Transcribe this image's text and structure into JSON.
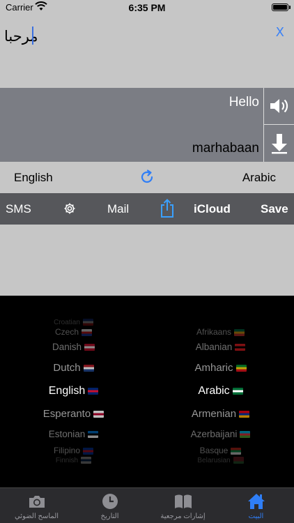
{
  "status": {
    "carrier": "Carrier",
    "time": "6:35 PM"
  },
  "input": {
    "text": "مرحبا",
    "clear_label": "X"
  },
  "output": {
    "source": "Hello",
    "transliteration": "marhabaan"
  },
  "languages": {
    "from": "English",
    "to": "Arabic"
  },
  "actions": {
    "sms": "SMS",
    "mail": "Mail",
    "icloud": "iCloud",
    "save": "Save"
  },
  "picker": {
    "left": [
      {
        "label": "Croatian",
        "flag": [
          "#1a3fa8",
          "#ffffff",
          "#d61c1c"
        ]
      },
      {
        "label": "Czech",
        "flag": [
          "#ffffff",
          "#d61c1c",
          "#1a3fa8"
        ]
      },
      {
        "label": "Danish",
        "flag": [
          "#c8102e",
          "#ffffff",
          "#c8102e"
        ]
      },
      {
        "label": "Dutch",
        "flag": [
          "#ae1c28",
          "#ffffff",
          "#21468b"
        ]
      },
      {
        "label": "English",
        "flag": [
          "#012169",
          "#c8102e",
          "#012169"
        ]
      },
      {
        "label": "Esperanto",
        "flag": [
          "#ffffff",
          "#bc002d",
          "#ffffff"
        ]
      },
      {
        "label": "Estonian",
        "flag": [
          "#0072ce",
          "#000000",
          "#ffffff"
        ]
      },
      {
        "label": "Filipino",
        "flag": [
          "#0038a8",
          "#ce1126",
          "#0038a8"
        ]
      },
      {
        "label": "Finnish",
        "flag": [
          "#ffffff",
          "#003580",
          "#ffffff"
        ]
      }
    ],
    "right": [
      {
        "label": "Afrikaans",
        "flag": [
          "#007a4d",
          "#ffb612",
          "#de3831"
        ]
      },
      {
        "label": "Albanian",
        "flag": [
          "#e41e20",
          "#000000",
          "#e41e20"
        ]
      },
      {
        "label": "Amharic",
        "flag": [
          "#078930",
          "#fcdd09",
          "#da121a"
        ]
      },
      {
        "label": "Arabic",
        "flag": [
          "#006c35",
          "#ffffff",
          "#006c35"
        ]
      },
      {
        "label": "Armenian",
        "flag": [
          "#d90012",
          "#0033a0",
          "#f2a800"
        ]
      },
      {
        "label": "Azerbaijani",
        "flag": [
          "#00b5e2",
          "#ef3340",
          "#509e2f"
        ]
      },
      {
        "label": "Basque",
        "flag": [
          "#d52b1e",
          "#009b48",
          "#ffffff"
        ]
      },
      {
        "label": "Belarusian",
        "flag": [
          "#c8313e",
          "#c8313e",
          "#4aa657"
        ]
      }
    ]
  },
  "tabs": [
    {
      "label": "الماسح الضوئي",
      "icon": "camera-icon"
    },
    {
      "label": "التاريخ",
      "icon": "clock-icon"
    },
    {
      "label": "إشارات مرجعية",
      "icon": "book-icon"
    },
    {
      "label": "البيت",
      "icon": "home-icon"
    }
  ],
  "colors": {
    "accent": "#2f7ef6",
    "output_bg": "#7b7d84",
    "action_bg": "#56575b"
  }
}
